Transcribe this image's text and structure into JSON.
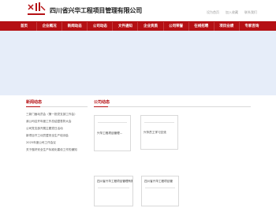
{
  "header": {
    "company_name": "四川省兴华工程项目管理有限公司",
    "top_links": [
      "设为首页",
      "加入收藏",
      "联系我们"
    ]
  },
  "nav": {
    "items": [
      "首页",
      "企业概况",
      "新闻动态",
      "公司动态",
      "文件通知",
      "企业资质",
      "公司荣誉",
      "在线招聘",
      "项目业绩",
      "专家咨询"
    ]
  },
  "left": {
    "title": "新闻动态",
    "items": [
      "三新门面动员会（第一批党支部工作会）",
      "我公司召开年度工作总结暨表彰大会",
      "公司党支部开展主题党日活动",
      "新项目开工动员暨安全生产培训会",
      "2025年度公司工作会议",
      "关于做好安全生产标准化建设工作的通知"
    ]
  },
  "right": {
    "title": "公司动态",
    "thumbs": [
      {
        "caption": "兴华工程项目管理..."
      },
      {
        "caption": "兴华员工学习交流"
      },
      {
        "caption": "四川省兴华工程项目管理有限"
      },
      {
        "caption": "四川省兴华工程项目管"
      }
    ]
  }
}
